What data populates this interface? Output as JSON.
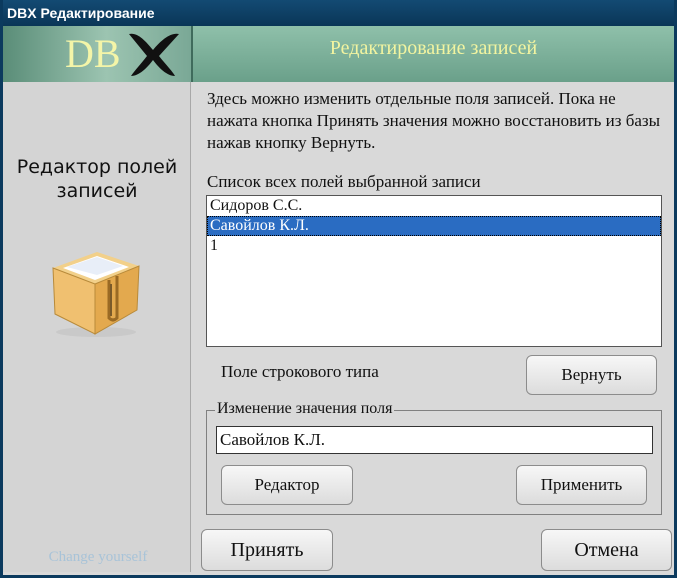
{
  "window": {
    "title": "DBX Редактирование"
  },
  "header": {
    "logo": "DB",
    "title": "Редактирование записей"
  },
  "sidebar": {
    "title_line1": "Редактор полей",
    "title_line2": "записей",
    "footer": "Change yourself"
  },
  "main": {
    "description": "Здесь можно изменить отдельные поля записей. Пока не нажата кнопка Принять значения можно восстановить из базы нажав кнопку Вернуть.",
    "list_title": "Список всех полей выбранной записи",
    "list_items": [
      "Сидоров С.С.",
      "Савойлов К.Л.",
      "1"
    ],
    "selected_index": 1,
    "field_type": "Поле строкового типа",
    "revert_label": "Вернуть",
    "group_label": "Изменение значения поля",
    "value": "Савойлов К.Л.",
    "editor_label": "Редактор",
    "apply_label": "Применить"
  },
  "footer": {
    "accept_label": "Принять",
    "cancel_label": "Отмена"
  },
  "colors": {
    "titlebar": "#0b3a5e",
    "header": "#7fb29c",
    "header_text": "#f2f4a0",
    "selection": "#2a6cc2"
  }
}
